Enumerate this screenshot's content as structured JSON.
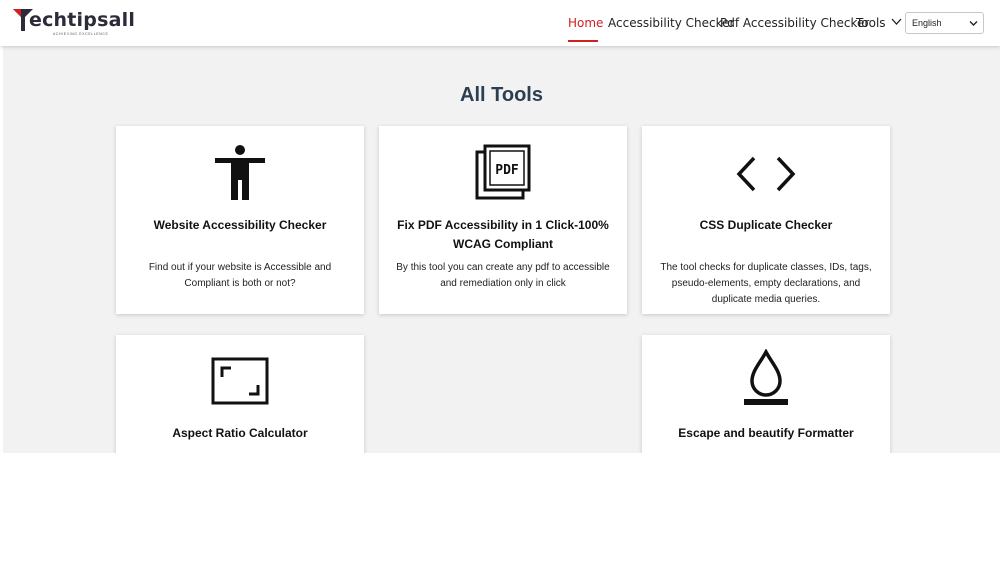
{
  "brand": {
    "name": "echtipsall",
    "tagline": "ACHIEVING EXCELLENCE",
    "accent": "#d12020"
  },
  "nav": {
    "home": "Home",
    "accessibility_checker": "Accessibility Checker",
    "pdf_checker": "Pdf Accessibility Checker",
    "tools": "Tools"
  },
  "language": {
    "selected": "English"
  },
  "page": {
    "title": "All Tools"
  },
  "cards": [
    {
      "title": "Website Accessibility Checker",
      "desc": "Find out if your website is Accessible and Compliant is both or not?",
      "icon": "accessibility-person-icon"
    },
    {
      "title": "Fix PDF Accessibility in 1 Click-100% WCAG Compliant",
      "desc": "By this tool you can create any pdf to accessible and remediation only in click",
      "icon": "pdf-icon"
    },
    {
      "title": "CSS Duplicate Checker",
      "desc": "The tool checks for duplicate classes, IDs, tags, pseudo-elements, empty declarations, and duplicate media queries.",
      "icon": "code-brackets-icon"
    },
    {
      "title": "Aspect Ratio Calculator",
      "desc": "",
      "icon": "aspect-ratio-icon"
    },
    {
      "title": "Escape and beautify Formatter",
      "desc": "",
      "icon": "drop-icon"
    }
  ]
}
